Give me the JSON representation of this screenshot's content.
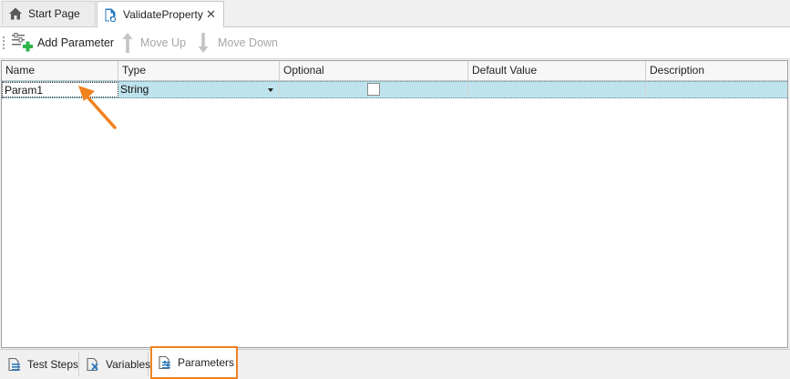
{
  "tabs": [
    {
      "label": "Start Page",
      "icon": "home-icon"
    },
    {
      "label": "ValidateProperty",
      "icon": "script-routine-icon",
      "active": true
    }
  ],
  "tab_close_glyph": "✕",
  "toolbar": {
    "add_label": "Add Parameter",
    "up_label": "Move Up",
    "down_label": "Move Down"
  },
  "grid": {
    "columns": [
      "Name",
      "Type",
      "Optional",
      "Default Value",
      "Description"
    ],
    "rows": [
      {
        "name": "Param1",
        "type": "String",
        "optional": false,
        "default_value": "",
        "description": ""
      }
    ]
  },
  "bottom_tabs": [
    {
      "label": "Test Steps",
      "icon": "test-steps-icon"
    },
    {
      "label": "Variables",
      "icon": "variables-icon"
    },
    {
      "label": "Parameters",
      "icon": "parameters-icon",
      "active": true
    }
  ],
  "colors": {
    "selected_row": "#bfe3ec",
    "highlight": "#f0821e",
    "add_green": "#2db34a",
    "home_gray": "#5a5a5a",
    "icon_blue": "#2b7bbf"
  }
}
